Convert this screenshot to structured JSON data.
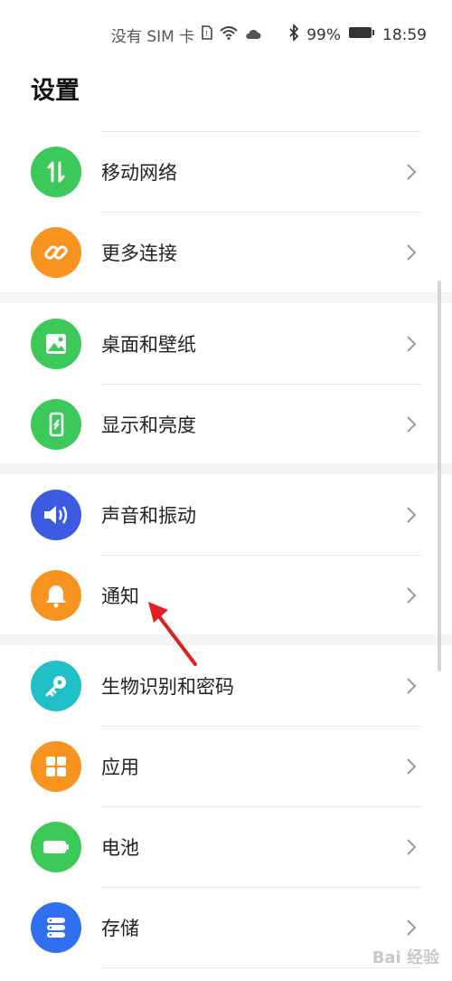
{
  "status_bar": {
    "carrier": "没有 SIM 卡",
    "battery": "99%",
    "time": "18:59"
  },
  "page": {
    "title": "设置"
  },
  "groups": [
    {
      "items": [
        {
          "label": "移动网络",
          "icon": "mobile-data-icon",
          "color": "#3dc85a"
        },
        {
          "label": "更多连接",
          "icon": "link-icon",
          "color": "#f7931e"
        }
      ]
    },
    {
      "items": [
        {
          "label": "桌面和壁纸",
          "icon": "wallpaper-icon",
          "color": "#3dc85a"
        },
        {
          "label": "显示和亮度",
          "icon": "display-icon",
          "color": "#3dc85a"
        }
      ]
    },
    {
      "items": [
        {
          "label": "声音和振动",
          "icon": "speaker-icon",
          "color": "#3b5be0"
        },
        {
          "label": "通知",
          "icon": "bell-icon",
          "color": "#f7931e"
        }
      ]
    },
    {
      "items": [
        {
          "label": "生物识别和密码",
          "icon": "key-icon",
          "color": "#20c0c8"
        },
        {
          "label": "应用",
          "icon": "apps-icon",
          "color": "#f7931e"
        },
        {
          "label": "电池",
          "icon": "battery-icon",
          "color": "#3dc85a"
        },
        {
          "label": "存储",
          "icon": "storage-icon",
          "color": "#2f6ff0"
        }
      ]
    }
  ],
  "watermark": "Bai 经验"
}
